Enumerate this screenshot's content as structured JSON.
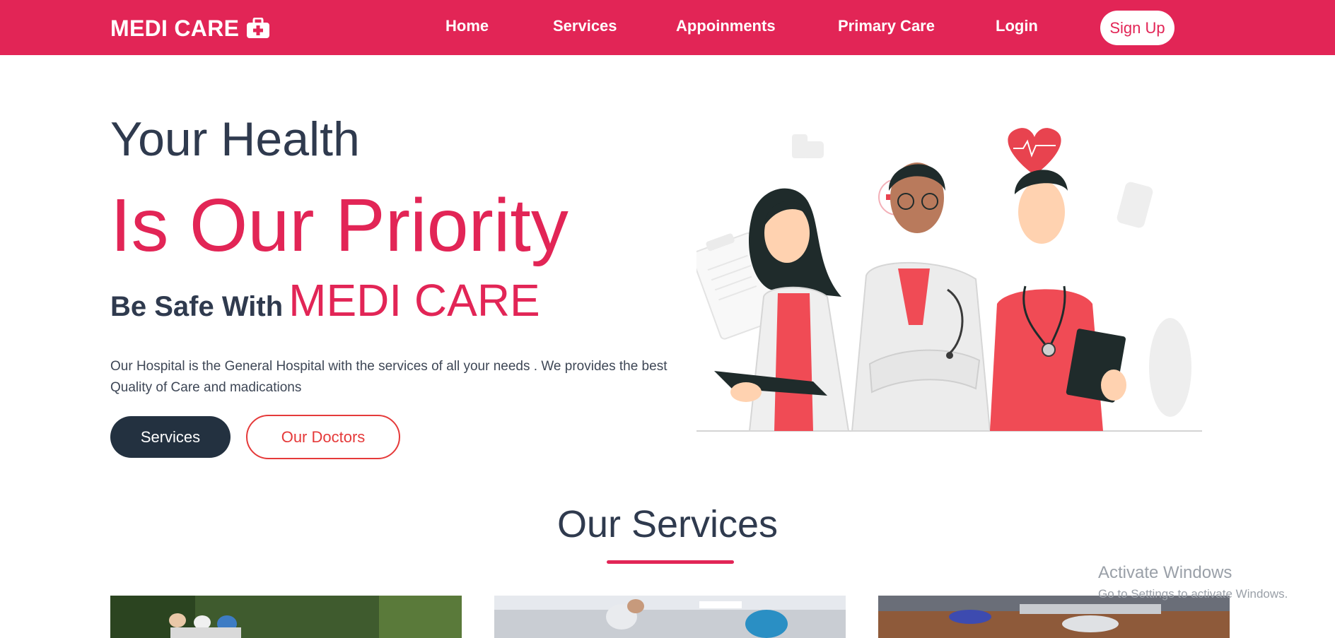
{
  "navbar": {
    "brand": "MEDI CARE",
    "brand_icon": "first-aid-kit-icon",
    "items": [
      {
        "label": "Home"
      },
      {
        "label": "Services"
      },
      {
        "label": "Appoinments"
      },
      {
        "label": "Primary Care"
      },
      {
        "label": "Login"
      }
    ],
    "signup_label": "Sign Up"
  },
  "hero": {
    "line1": "Your Health",
    "line2": "Is Our Priority",
    "line3_lead": "Be Safe With",
    "line3_brand": "MEDI CARE",
    "description": "Our Hospital is the General Hospital with the services of all your needs . We provides the best Quality of Care and madications",
    "primary_button": "Services",
    "secondary_button": "Our Doctors",
    "illustration": "doctors-illustration"
  },
  "services_section": {
    "title": "Our Services",
    "cards": [
      {
        "image": "patients-outdoor-photo"
      },
      {
        "image": "hospital-corridor-photo"
      },
      {
        "image": "operating-room-photo"
      }
    ]
  },
  "watermark": {
    "line1": "Activate Windows",
    "line2": "Go to Settings to activate Windows."
  },
  "colors": {
    "brand": "#e22556",
    "dark": "#2f3a4e",
    "button_dark": "#233140",
    "outline_red": "#e53a3a"
  }
}
